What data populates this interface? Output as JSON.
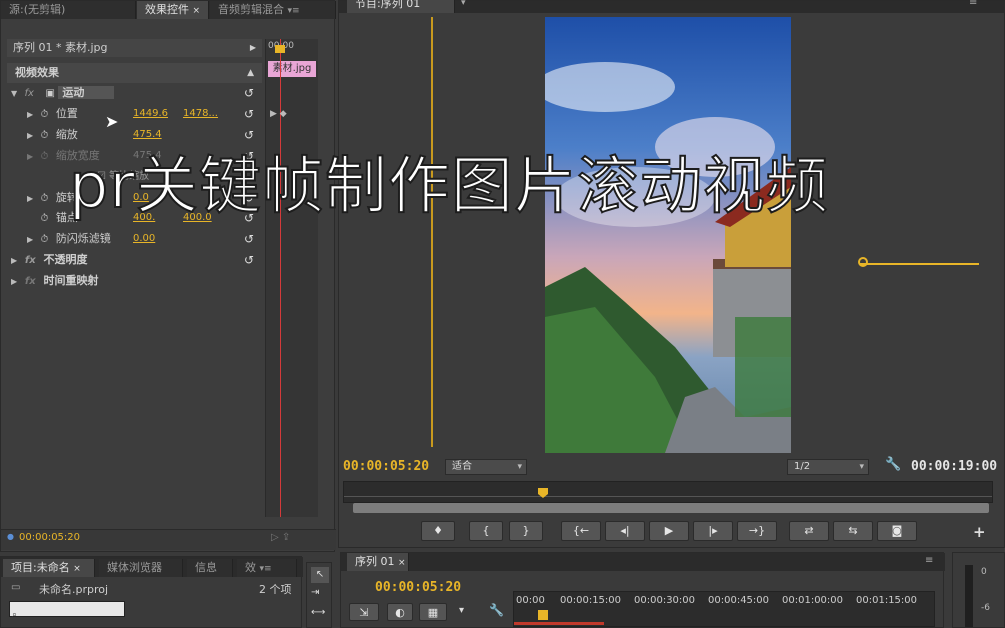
{
  "left_tabs": [
    {
      "label": "源:(无剪辑)",
      "active": false
    },
    {
      "label": "效果控件",
      "active": true
    },
    {
      "label": "音频剪辑混合",
      "active": false
    }
  ],
  "effects": {
    "clip_header": "序列 01 * 素材.jpg",
    "timeline_clip_label": "素材.jpg",
    "timeline_start": "00:00",
    "video_effects_label": "视频效果",
    "motion_label": "运动",
    "params": [
      {
        "name": "位置",
        "v1": "1449.6",
        "v2": "1478..."
      },
      {
        "name": "缩放",
        "v1": "475.4",
        "v2": ""
      },
      {
        "name": "缩放宽度",
        "v1": "475.4",
        "v2": ""
      },
      {
        "name": "等比缩放",
        "v1": "",
        "v2": ""
      },
      {
        "name": "旋转",
        "v1": "0.0",
        "v2": ""
      },
      {
        "name": "锚点",
        "v1": "400.",
        "v2": "400.0"
      },
      {
        "name": "防闪烁滤镜",
        "v1": "0.00",
        "v2": ""
      }
    ],
    "opacity_label": "不透明度",
    "time_remap_label": "时间重映射",
    "current_time": "00:00:05:20"
  },
  "program": {
    "tab_label": "节目:序列 01",
    "current_time": "00:00:05:20",
    "fit_label": "适合",
    "quality_label": "1/2",
    "duration": "00:00:19:00",
    "transport": [
      "♦",
      "{",
      "}",
      "{←",
      "◂|",
      "▶",
      "|▸",
      "→}",
      "⇄",
      "⇆",
      "camera-icon"
    ]
  },
  "overlay_title": "pr关键帧制作图片滚动视频",
  "project": {
    "tabs": [
      "项目:未命名",
      "媒体浏览器",
      "信息",
      "效"
    ],
    "file_name": "未命名.prproj",
    "item_count": "2 个项"
  },
  "timeline": {
    "tab_label": "序列 01",
    "current_time": "00:00:05:20",
    "ruler": [
      "00:00",
      "00:00:15:00",
      "00:00:30:00",
      "00:00:45:00",
      "00:01:00:00",
      "00:01:15:00"
    ]
  },
  "audio_meter": {
    "labels": [
      "0",
      "-6"
    ]
  },
  "colors": {
    "accent": "#e8b528",
    "clip_pink": "#e9a6d6"
  }
}
